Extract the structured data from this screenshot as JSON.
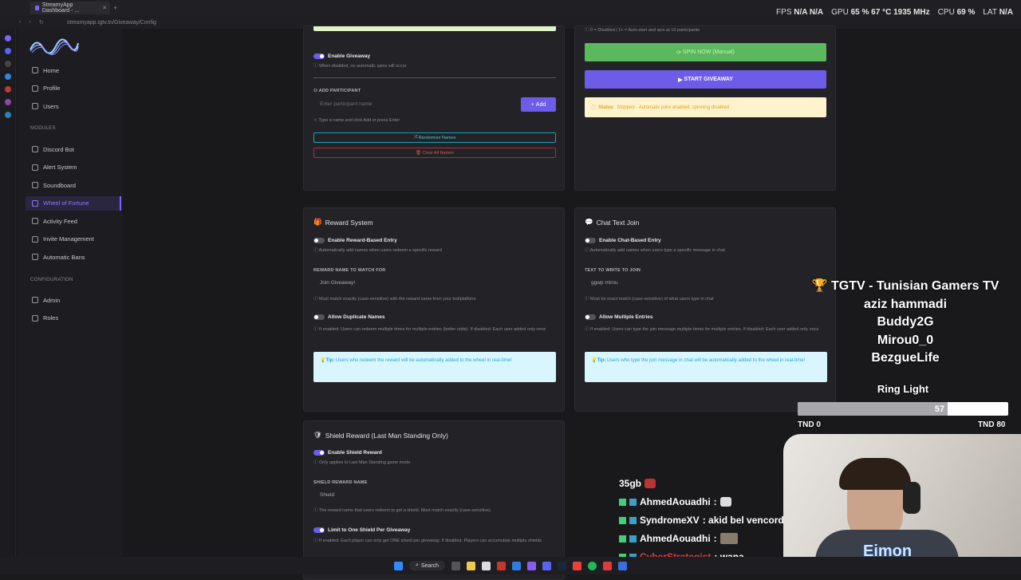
{
  "browser": {
    "tab_title": "StreamyApp Dashboard - ...",
    "url": "streamyapp.tgtv.tn/Giveaway/Config"
  },
  "overlay_stats": {
    "fps_label": "FPS",
    "fps": "N/A",
    "fps2": "N/A",
    "gpu_label": "GPU",
    "gpu": "65 % 67 °C 1935 MHz",
    "cpu_label": "CPU",
    "cpu": "69 %",
    "lat_label": "LAT",
    "lat": "N/A"
  },
  "sidebar": {
    "items_top": [
      "Home",
      "Profile",
      "Users"
    ],
    "modules_heading": "MODULES",
    "modules": [
      "Discord Bot",
      "Alert System",
      "Soundboard",
      "Wheel of Fortune",
      "Activity Feed",
      "Invite Management",
      "Automatic Bans"
    ],
    "config_heading": "CONFIGURATION",
    "config": [
      "Admin",
      "Roles"
    ]
  },
  "giveaway_card": {
    "enable_label": "Enable Giveaway",
    "enable_help": "When disabled, no automatic spins will occur",
    "add_participant_label": "ADD PARTICIPANT",
    "participant_placeholder": "Enter participant name",
    "add_button": "Add",
    "add_help": "Type a name and click Add or press Enter",
    "randomize_button": "Randomize Names",
    "clear_button": "Clear All Names"
  },
  "controls_card": {
    "top_help": "0 = Disabled | 1+ = Auto-start and spin at 10 participants",
    "spin_button": "SPIN NOW (Manual)",
    "start_button": "START GIVEAWAY",
    "status_label": "Status:",
    "status_text": "Stopped - Automatic joins enabled, spinning disabled"
  },
  "reward_card": {
    "title": "Reward System",
    "enable_label": "Enable Reward-Based Entry",
    "enable_help": "Automatically add names when users redeem a specific reward",
    "watch_label": "REWARD NAME TO WATCH FOR",
    "watch_value": "Join Giveaway!",
    "watch_help": "Must match exactly (case-sensitive) with the reward name from your bot/platform",
    "dup_label": "Allow Duplicate Names",
    "dup_help": "If enabled: Users can redeem multiple times for multiple entries (better odds). If disabled: Each user added only once",
    "tip_label": "Tip:",
    "tip_text": "Users who redeem the reward will be automatically added to the wheel in real-time!"
  },
  "chat_card": {
    "title": "Chat Text Join",
    "enable_label": "Enable Chat-Based Entry",
    "enable_help": "Automatically add names when users type a specific message in chat",
    "text_label": "TEXT TO WRITE TO JOIN",
    "text_value": "ggwp mirou",
    "text_help": "Must be exact match (case-sensitive) of what users type in chat",
    "multi_label": "Allow Multiple Entries",
    "multi_help": "If enabled: Users can type the join message multiple times for multiple entries. If disabled: Each user added only once",
    "tip_label": "Tip:",
    "tip_text": "Users who type the join message in chat will be automatically added to the wheel in real-time!"
  },
  "shield_card": {
    "title": "Shield Reward (Last Man Standing Only)",
    "enable_label": "Enable Shield Reward",
    "enable_help": "Only applies to Last Man Standing game mode",
    "name_label": "SHIELD REWARD NAME",
    "name_value": "Shield",
    "name_help": "The reward name that users redeem to get a shield. Must match exactly (case-sensitive)",
    "limit_label": "Limit to One Shield Per Giveaway",
    "limit_help": "If enabled: Each player can only get ONE shield per giveaway. If disabled: Players can accumulate multiple shields"
  },
  "stream_overlay": {
    "supporters": [
      "TGTV - Tunisian Gamers TV",
      "aziz hammadi",
      "Buddy2G",
      "Mirou0_0",
      "BezgueLife"
    ],
    "goal_title": "Ring Light",
    "goal_value": "57",
    "goal_fraction": 0.7125,
    "goal_min": "TND 0",
    "goal_max": "TND 80",
    "chat": [
      {
        "user": "35gb",
        "msg": ""
      },
      {
        "user": "AhmedAouadhi",
        "msg": ":"
      },
      {
        "user": "SyndromeXV",
        "msg": ": akid bel vencord"
      },
      {
        "user": "AhmedAouadhi",
        "msg": ":"
      },
      {
        "user": "CyberStrategist",
        "msg": ": wana"
      }
    ],
    "cam_name": "Eimon"
  },
  "taskbar": {
    "search_label": "Search"
  },
  "colors": {
    "accent": "#6c5ce7",
    "spin_green": "#5cb85c",
    "status_bg": "#fff3cd",
    "tip_bg": "#d9f6ff"
  }
}
